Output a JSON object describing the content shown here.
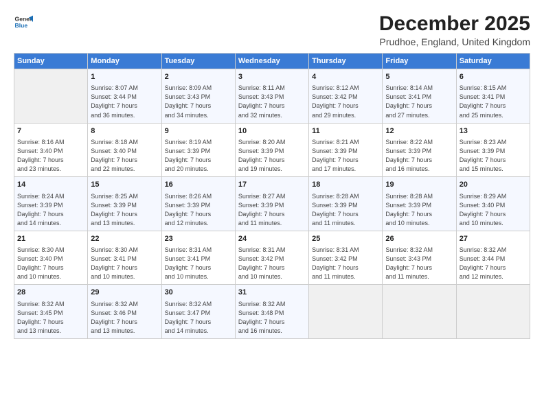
{
  "header": {
    "logo_line1": "General",
    "logo_line2": "Blue",
    "title": "December 2025",
    "subtitle": "Prudhoe, England, United Kingdom"
  },
  "days_of_week": [
    "Sunday",
    "Monday",
    "Tuesday",
    "Wednesday",
    "Thursday",
    "Friday",
    "Saturday"
  ],
  "weeks": [
    [
      {
        "day": "",
        "content": ""
      },
      {
        "day": "1",
        "content": "Sunrise: 8:07 AM\nSunset: 3:44 PM\nDaylight: 7 hours\nand 36 minutes."
      },
      {
        "day": "2",
        "content": "Sunrise: 8:09 AM\nSunset: 3:43 PM\nDaylight: 7 hours\nand 34 minutes."
      },
      {
        "day": "3",
        "content": "Sunrise: 8:11 AM\nSunset: 3:43 PM\nDaylight: 7 hours\nand 32 minutes."
      },
      {
        "day": "4",
        "content": "Sunrise: 8:12 AM\nSunset: 3:42 PM\nDaylight: 7 hours\nand 29 minutes."
      },
      {
        "day": "5",
        "content": "Sunrise: 8:14 AM\nSunset: 3:41 PM\nDaylight: 7 hours\nand 27 minutes."
      },
      {
        "day": "6",
        "content": "Sunrise: 8:15 AM\nSunset: 3:41 PM\nDaylight: 7 hours\nand 25 minutes."
      }
    ],
    [
      {
        "day": "7",
        "content": "Sunrise: 8:16 AM\nSunset: 3:40 PM\nDaylight: 7 hours\nand 23 minutes."
      },
      {
        "day": "8",
        "content": "Sunrise: 8:18 AM\nSunset: 3:40 PM\nDaylight: 7 hours\nand 22 minutes."
      },
      {
        "day": "9",
        "content": "Sunrise: 8:19 AM\nSunset: 3:39 PM\nDaylight: 7 hours\nand 20 minutes."
      },
      {
        "day": "10",
        "content": "Sunrise: 8:20 AM\nSunset: 3:39 PM\nDaylight: 7 hours\nand 19 minutes."
      },
      {
        "day": "11",
        "content": "Sunrise: 8:21 AM\nSunset: 3:39 PM\nDaylight: 7 hours\nand 17 minutes."
      },
      {
        "day": "12",
        "content": "Sunrise: 8:22 AM\nSunset: 3:39 PM\nDaylight: 7 hours\nand 16 minutes."
      },
      {
        "day": "13",
        "content": "Sunrise: 8:23 AM\nSunset: 3:39 PM\nDaylight: 7 hours\nand 15 minutes."
      }
    ],
    [
      {
        "day": "14",
        "content": "Sunrise: 8:24 AM\nSunset: 3:39 PM\nDaylight: 7 hours\nand 14 minutes."
      },
      {
        "day": "15",
        "content": "Sunrise: 8:25 AM\nSunset: 3:39 PM\nDaylight: 7 hours\nand 13 minutes."
      },
      {
        "day": "16",
        "content": "Sunrise: 8:26 AM\nSunset: 3:39 PM\nDaylight: 7 hours\nand 12 minutes."
      },
      {
        "day": "17",
        "content": "Sunrise: 8:27 AM\nSunset: 3:39 PM\nDaylight: 7 hours\nand 11 minutes."
      },
      {
        "day": "18",
        "content": "Sunrise: 8:28 AM\nSunset: 3:39 PM\nDaylight: 7 hours\nand 11 minutes."
      },
      {
        "day": "19",
        "content": "Sunrise: 8:28 AM\nSunset: 3:39 PM\nDaylight: 7 hours\nand 10 minutes."
      },
      {
        "day": "20",
        "content": "Sunrise: 8:29 AM\nSunset: 3:40 PM\nDaylight: 7 hours\nand 10 minutes."
      }
    ],
    [
      {
        "day": "21",
        "content": "Sunrise: 8:30 AM\nSunset: 3:40 PM\nDaylight: 7 hours\nand 10 minutes."
      },
      {
        "day": "22",
        "content": "Sunrise: 8:30 AM\nSunset: 3:41 PM\nDaylight: 7 hours\nand 10 minutes."
      },
      {
        "day": "23",
        "content": "Sunrise: 8:31 AM\nSunset: 3:41 PM\nDaylight: 7 hours\nand 10 minutes."
      },
      {
        "day": "24",
        "content": "Sunrise: 8:31 AM\nSunset: 3:42 PM\nDaylight: 7 hours\nand 10 minutes."
      },
      {
        "day": "25",
        "content": "Sunrise: 8:31 AM\nSunset: 3:42 PM\nDaylight: 7 hours\nand 11 minutes."
      },
      {
        "day": "26",
        "content": "Sunrise: 8:32 AM\nSunset: 3:43 PM\nDaylight: 7 hours\nand 11 minutes."
      },
      {
        "day": "27",
        "content": "Sunrise: 8:32 AM\nSunset: 3:44 PM\nDaylight: 7 hours\nand 12 minutes."
      }
    ],
    [
      {
        "day": "28",
        "content": "Sunrise: 8:32 AM\nSunset: 3:45 PM\nDaylight: 7 hours\nand 13 minutes."
      },
      {
        "day": "29",
        "content": "Sunrise: 8:32 AM\nSunset: 3:46 PM\nDaylight: 7 hours\nand 13 minutes."
      },
      {
        "day": "30",
        "content": "Sunrise: 8:32 AM\nSunset: 3:47 PM\nDaylight: 7 hours\nand 14 minutes."
      },
      {
        "day": "31",
        "content": "Sunrise: 8:32 AM\nSunset: 3:48 PM\nDaylight: 7 hours\nand 16 minutes."
      },
      {
        "day": "",
        "content": ""
      },
      {
        "day": "",
        "content": ""
      },
      {
        "day": "",
        "content": ""
      }
    ]
  ]
}
